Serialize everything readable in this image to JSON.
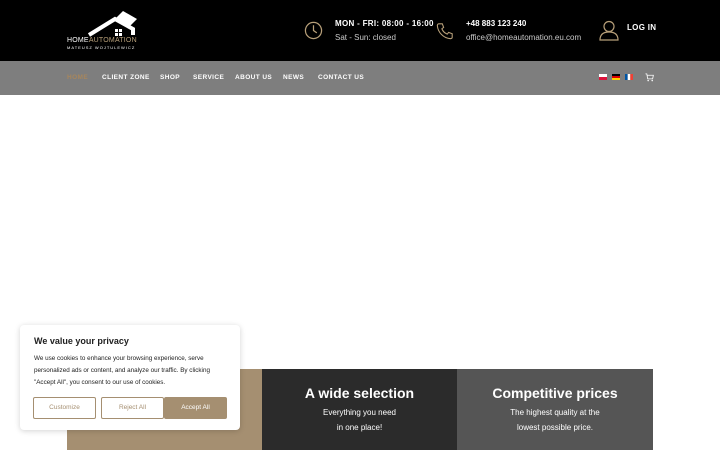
{
  "header": {
    "logo": {
      "name": "HOMEAUTOMATION",
      "name_part1": "HOME",
      "name_part2": "AUTOMATION",
      "sub": "MATEUSZ WOJTULEWICZ"
    },
    "hours": {
      "line1": "MON - FRI: 08:00 - 16:00",
      "line2": "Sat - Sun: closed"
    },
    "contact": {
      "phone": "+48 883 123 240",
      "email": "office@homeautomation.eu.com"
    },
    "login_label": "LOG IN"
  },
  "nav": {
    "items": [
      {
        "label": "HOME",
        "active": true
      },
      {
        "label": "CLIENT ZONE"
      },
      {
        "label": "SHOP"
      },
      {
        "label": "SERVICE"
      },
      {
        "label": "ABOUT US"
      },
      {
        "label": "NEWS"
      },
      {
        "label": "CONTACT US"
      }
    ],
    "flags": [
      "polish-flag-icon",
      "german-flag-icon",
      "french-flag-icon"
    ],
    "cart_icon": "cart-icon"
  },
  "features": [
    {
      "title": "",
      "line1": "",
      "line2": ""
    },
    {
      "title": "A wide selection",
      "line1": "Everything you need",
      "line2": "in one place!"
    },
    {
      "title": "Competitive prices",
      "line1": "The highest quality at the",
      "line2": "lowest possible price."
    }
  ],
  "cookie": {
    "title": "We value your privacy",
    "text": "We use cookies to enhance your browsing experience, serve personalized ads or content, and analyze our traffic. By clicking \"Accept All\", you consent to our use of cookies.",
    "customize": "Customize",
    "reject": "Reject All",
    "accept": "Accept All"
  },
  "colors": {
    "accent": "#a58f71",
    "topbar": "#000000",
    "navbar": "#7e7e7e",
    "active_nav": "#a7865c"
  }
}
